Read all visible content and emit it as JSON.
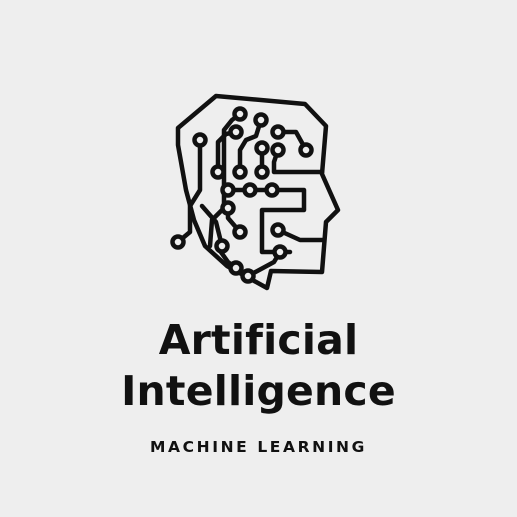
{
  "logo": {
    "title_line_1": "Artificial",
    "title_line_2": "Intelligence",
    "subtitle": "MACHINE LEARNING",
    "icon": "circuit-head-icon",
    "colors": {
      "background": "#eeeeee",
      "ink": "#111111"
    }
  }
}
